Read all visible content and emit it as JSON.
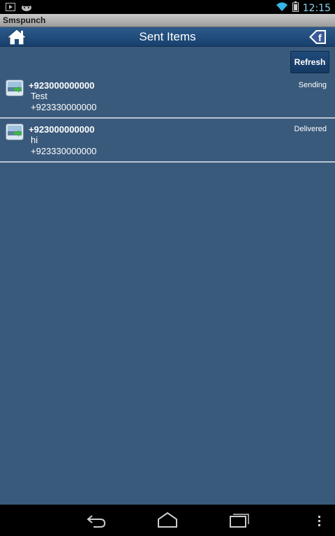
{
  "status": {
    "time": "12:15"
  },
  "app": {
    "title": "Smspunch"
  },
  "header": {
    "title": "Sent Items"
  },
  "toolbar": {
    "refresh_label": "Refresh"
  },
  "messages": [
    {
      "recipient": "+923000000000",
      "text": "Test",
      "sender": "+923330000000",
      "status": "Sending"
    },
    {
      "recipient": "+923000000000",
      "text": "hi",
      "sender": "+923330000000",
      "status": "Delivered"
    }
  ],
  "colors": {
    "background": "#3a5a7c",
    "header": "#1f4a7a",
    "accent": "#8fd4f0"
  },
  "icons": [
    "play-icon",
    "android-icon",
    "wifi-icon",
    "battery-icon",
    "home-icon",
    "facebook-icon",
    "message-icon",
    "back-icon",
    "home-nav-icon",
    "recent-apps-icon",
    "overflow-menu-icon"
  ]
}
